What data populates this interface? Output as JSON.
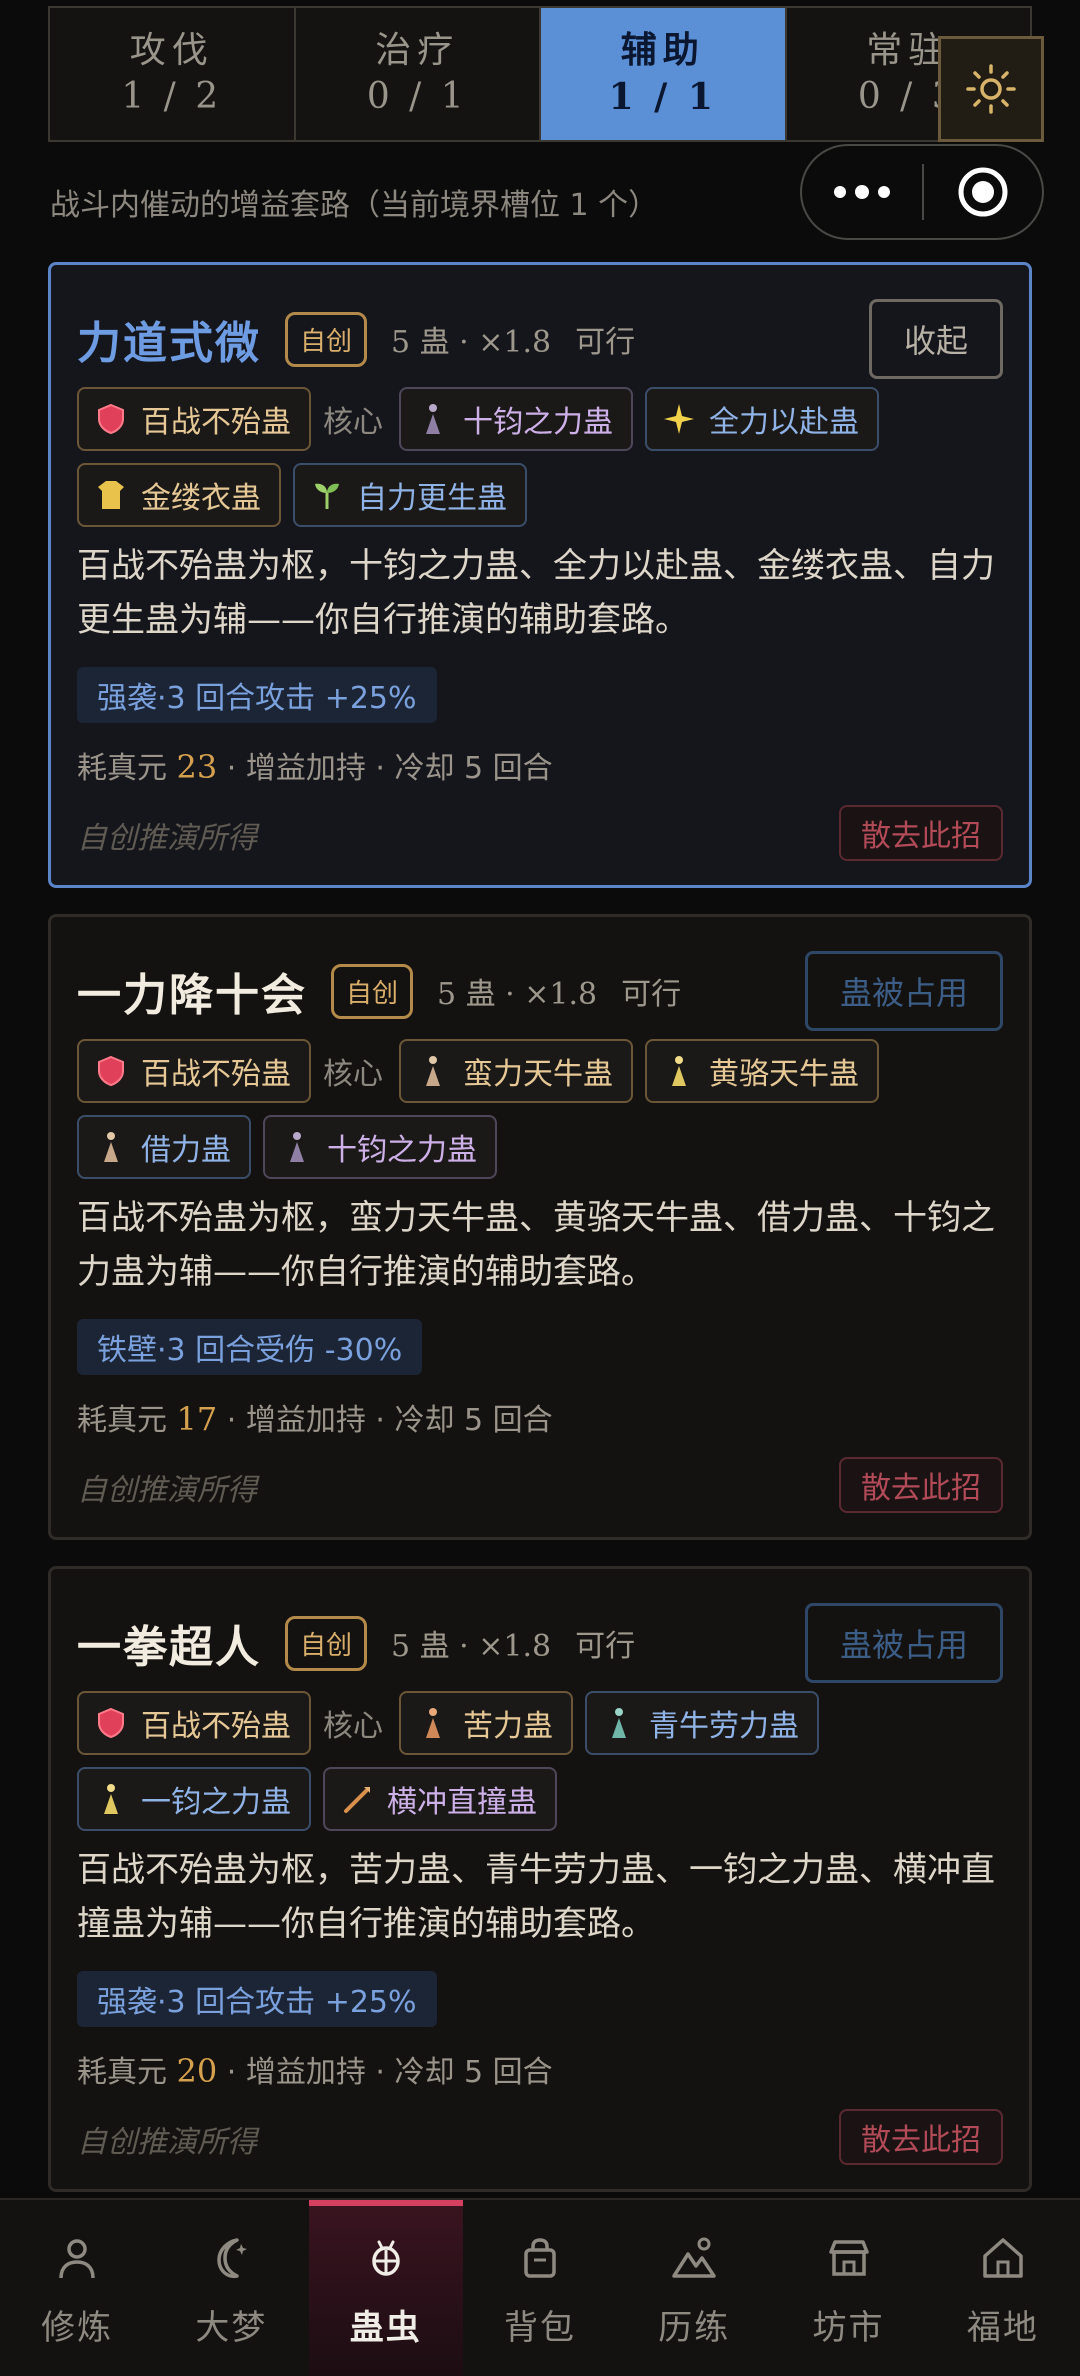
{
  "tabs": [
    {
      "name": "攻伐",
      "count": "1 / 2"
    },
    {
      "name": "治疗",
      "count": "0 / 1"
    },
    {
      "name": "辅助",
      "count": "1 / 1"
    },
    {
      "name": "常驻",
      "count": "0 / 3"
    }
  ],
  "subtitle": "战斗内催动的增益套路（当前境界槽位 1 个）",
  "cards": [
    {
      "title": "力道式微",
      "badge": "自创",
      "meta": "5 蛊 · ×1.8",
      "feasible": "可行",
      "action": "收起",
      "chips_row1": [
        {
          "label": "百战不殆蛊",
          "icon": "shield-icon"
        },
        {
          "label": "核心"
        },
        {
          "label": "十钧之力蛊",
          "icon": "figure-icon"
        },
        {
          "label": "全力以赴蛊",
          "icon": "sparkle-icon"
        }
      ],
      "chips_row2": [
        {
          "label": "金缕衣蛊",
          "icon": "robe-icon"
        },
        {
          "label": "自力更生蛊",
          "icon": "sprout-icon"
        }
      ],
      "desc": "百战不殆蛊为枢，十钧之力蛊、全力以赴蛊、金缕衣蛊、自力更生蛊为辅——你自行推演的辅助套路。",
      "buff": "强袭·3 回合攻击 +25%",
      "cost_prefix": "耗真元 ",
      "cost": "23",
      "cost_suffix": " · 增益加持 · 冷却 5 回合",
      "origin": "自创推演所得",
      "dismiss": "散去此招"
    },
    {
      "title": "一力降十会",
      "badge": "自创",
      "meta": "5 蛊 · ×1.8",
      "feasible": "可行",
      "action": "蛊被占用",
      "chips_row1": [
        {
          "label": "百战不殆蛊",
          "icon": "shield-icon"
        },
        {
          "label": "核心"
        },
        {
          "label": "蛮力天牛蛊",
          "icon": "figure-icon"
        },
        {
          "label": "黄骆天牛蛊",
          "icon": "figure-icon"
        }
      ],
      "chips_row2": [
        {
          "label": "借力蛊",
          "icon": "figure-icon"
        },
        {
          "label": "十钧之力蛊",
          "icon": "figure-icon"
        }
      ],
      "desc": "百战不殆蛊为枢，蛮力天牛蛊、黄骆天牛蛊、借力蛊、十钧之力蛊为辅——你自行推演的辅助套路。",
      "buff": "铁壁·3 回合受伤 -30%",
      "cost_prefix": "耗真元 ",
      "cost": "17",
      "cost_suffix": " · 增益加持 · 冷却 5 回合",
      "origin": "自创推演所得",
      "dismiss": "散去此招"
    },
    {
      "title": "一拳超人",
      "badge": "自创",
      "meta": "5 蛊 · ×1.8",
      "feasible": "可行",
      "action": "蛊被占用",
      "chips_row1": [
        {
          "label": "百战不殆蛊",
          "icon": "shield-icon"
        },
        {
          "label": "核心"
        },
        {
          "label": "苦力蛊",
          "icon": "figure-icon"
        },
        {
          "label": "青牛劳力蛊",
          "icon": "figure-icon"
        }
      ],
      "chips_row2": [
        {
          "label": "一钧之力蛊",
          "icon": "figure-icon"
        },
        {
          "label": "横冲直撞蛊",
          "icon": "spear-icon"
        }
      ],
      "desc": "百战不殆蛊为枢，苦力蛊、青牛劳力蛊、一钧之力蛊、横冲直撞蛊为辅——你自行推演的辅助套路。",
      "buff": "强袭·3 回合攻击 +25%",
      "cost_prefix": "耗真元 ",
      "cost": "20",
      "cost_suffix": " · 增益加持 · 冷却 5 回合",
      "origin": "自创推演所得",
      "dismiss": "散去此招"
    }
  ],
  "nav": [
    {
      "label": "修炼",
      "icon": "person-icon"
    },
    {
      "label": "大梦",
      "icon": "moon-icon"
    },
    {
      "label": "蛊虫",
      "icon": "bug-icon"
    },
    {
      "label": "背包",
      "icon": "bag-icon"
    },
    {
      "label": "历练",
      "icon": "mountain-icon"
    },
    {
      "label": "坊市",
      "icon": "shop-icon"
    },
    {
      "label": "福地",
      "icon": "home-icon"
    }
  ],
  "colors": {
    "accent": "#5b8fd6",
    "core": "#e6c896",
    "danger": "#b24b57",
    "nav_active": "#d4405f"
  }
}
